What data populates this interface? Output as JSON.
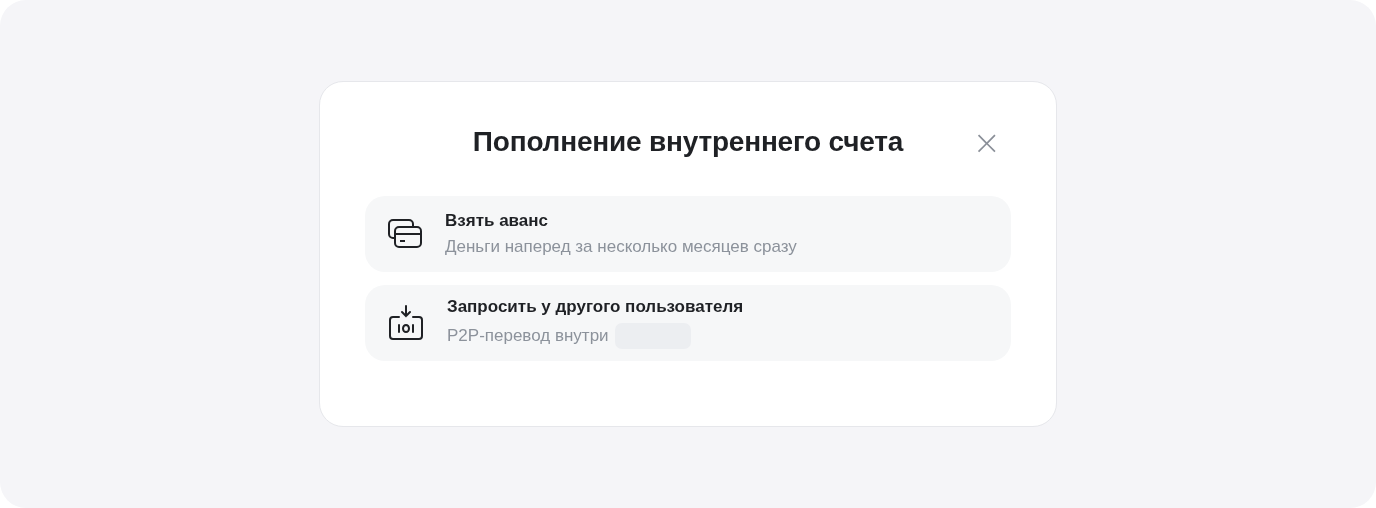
{
  "dialog": {
    "title": "Пополнение внутреннего счета",
    "close": "×"
  },
  "options": [
    {
      "kind": "cards",
      "title": "Взять аванс",
      "subtitle": "Деньги наперед за несколько месяцев сразу",
      "redacted": false
    },
    {
      "kind": "request",
      "title": "Запросить у другого пользователя",
      "subtitle": "P2P-перевод внутри",
      "redacted": true
    }
  ]
}
